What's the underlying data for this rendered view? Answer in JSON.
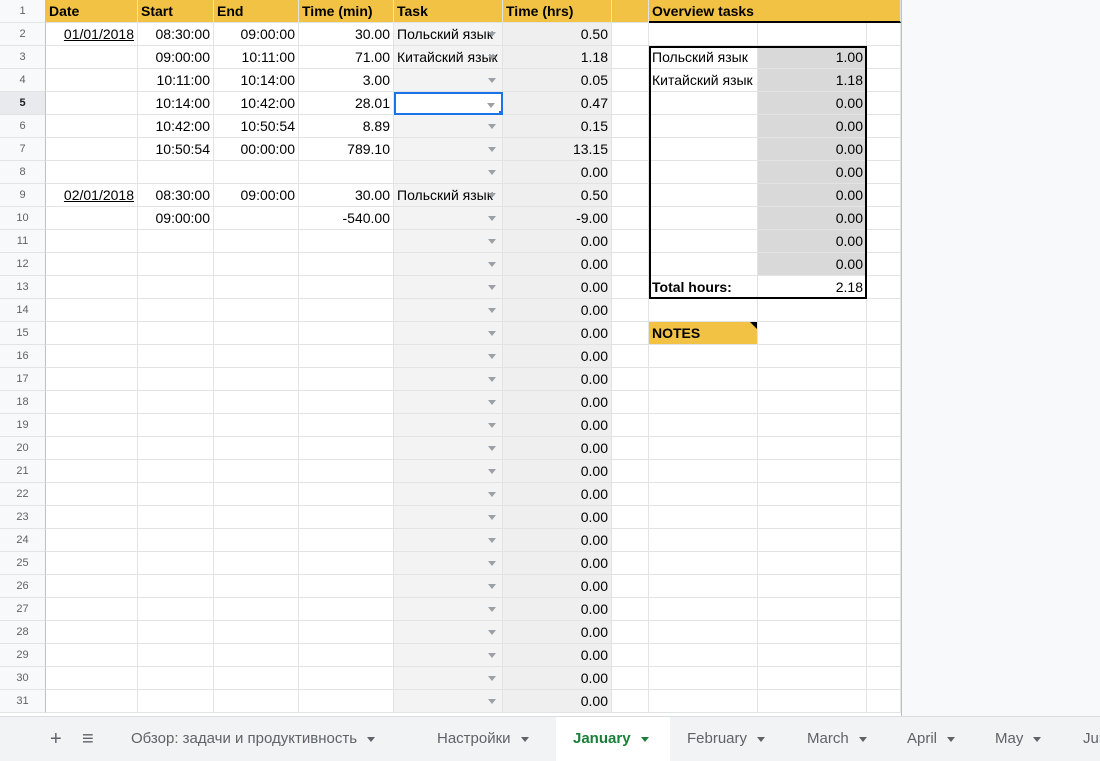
{
  "header": {
    "date": "Date",
    "start": "Start",
    "end": "End",
    "time_min": "Time (min)",
    "task": "Task",
    "time_hrs": "Time (hrs)",
    "overview": "Overview tasks"
  },
  "rows": [
    {
      "n": "1"
    },
    {
      "n": "2",
      "date": "01/01/2018",
      "start": "08:30:00",
      "end": "09:00:00",
      "tmin": "30.00",
      "task": "Польский язык",
      "hrs": "0.50"
    },
    {
      "n": "3",
      "start": "09:00:00",
      "end": "10:11:00",
      "tmin": "71.00",
      "task": "Китайский язык",
      "hrs": "1.18"
    },
    {
      "n": "4",
      "start": "10:11:00",
      "end": "10:14:00",
      "tmin": "3.00",
      "task": "",
      "hrs": "0.05"
    },
    {
      "n": "5",
      "start": "10:14:00",
      "end": "10:42:00",
      "tmin": "28.01",
      "task": "",
      "hrs": "0.47"
    },
    {
      "n": "6",
      "start": "10:42:00",
      "end": "10:50:54",
      "tmin": "8.89",
      "task": "",
      "hrs": "0.15"
    },
    {
      "n": "7",
      "start": "10:50:54",
      "end": "00:00:00",
      "tmin": "789.10",
      "task": "",
      "hrs": "13.15"
    },
    {
      "n": "8",
      "hrs": "0.00"
    },
    {
      "n": "9",
      "date": "02/01/2018",
      "start": "08:30:00",
      "end": "09:00:00",
      "tmin": "30.00",
      "task": "Польский язык",
      "hrs": "0.50"
    },
    {
      "n": "10",
      "start": "09:00:00",
      "tmin": "-540.00",
      "hrs": "-9.00"
    },
    {
      "n": "11",
      "hrs": "0.00"
    },
    {
      "n": "12",
      "hrs": "0.00"
    },
    {
      "n": "13",
      "hrs": "0.00"
    },
    {
      "n": "14",
      "hrs": "0.00"
    },
    {
      "n": "15",
      "hrs": "0.00"
    },
    {
      "n": "16",
      "hrs": "0.00"
    },
    {
      "n": "17",
      "hrs": "0.00"
    },
    {
      "n": "18",
      "hrs": "0.00"
    },
    {
      "n": "19",
      "hrs": "0.00"
    },
    {
      "n": "20",
      "hrs": "0.00"
    },
    {
      "n": "21",
      "hrs": "0.00"
    },
    {
      "n": "22",
      "hrs": "0.00"
    },
    {
      "n": "23",
      "hrs": "0.00"
    },
    {
      "n": "24",
      "hrs": "0.00"
    },
    {
      "n": "25",
      "hrs": "0.00"
    },
    {
      "n": "26",
      "hrs": "0.00"
    },
    {
      "n": "27",
      "hrs": "0.00"
    },
    {
      "n": "28",
      "hrs": "0.00"
    },
    {
      "n": "29",
      "hrs": "0.00"
    },
    {
      "n": "30",
      "hrs": "0.00"
    },
    {
      "n": "31",
      "hrs": "0.00"
    }
  ],
  "overview": {
    "items": [
      {
        "label": "Польский язык",
        "value": "1.00"
      },
      {
        "label": "Китайский язык",
        "value": "1.18"
      },
      {
        "label": "",
        "value": "0.00"
      },
      {
        "label": "",
        "value": "0.00"
      },
      {
        "label": "",
        "value": "0.00"
      },
      {
        "label": "",
        "value": "0.00"
      },
      {
        "label": "",
        "value": "0.00"
      },
      {
        "label": "",
        "value": "0.00"
      },
      {
        "label": "",
        "value": "0.00"
      },
      {
        "label": "",
        "value": "0.00"
      }
    ],
    "total_label": "Total hours:",
    "total_value": "2.18",
    "notes_label": "NOTES"
  },
  "selected_row": "5",
  "sheet_tabs": [
    {
      "label": "Обзор: задачи и продуктивность",
      "active": false
    },
    {
      "label": "Настройки",
      "active": false
    },
    {
      "label": "January",
      "active": true
    },
    {
      "label": "February",
      "active": false
    },
    {
      "label": "March",
      "active": false
    },
    {
      "label": "April",
      "active": false
    },
    {
      "label": "May",
      "active": false
    },
    {
      "label": "Jun",
      "active": false
    }
  ],
  "tab_controls": {
    "add": "+",
    "list": "≡"
  },
  "colors": {
    "header": "#f2c244",
    "active_tab": "#188038",
    "selection": "#1a73e8"
  }
}
